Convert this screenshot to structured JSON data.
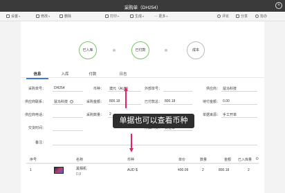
{
  "window": {
    "title": "采购单（DH254）"
  },
  "toolbar": {
    "settings": "设置",
    "edit": "修改",
    "delete": "删除",
    "print": "打印",
    "generate": "生成",
    "more": "更多",
    "comment": "评论",
    "share": "分享",
    "collab": "协办"
  },
  "steps": {
    "s1": "已入库",
    "s2": "已付款",
    "s3": "成本"
  },
  "tabs": {
    "info": "信息",
    "inbound": "入库",
    "payment": "付款",
    "log": "日志"
  },
  "fields": {
    "order_no_label": "采购单号：",
    "order_no": "DH254",
    "currency_label": "币种：",
    "currency": "澳元（AUD）",
    "ext_no_label": "外部单号：",
    "ext_no": "",
    "supplier_label": "供应商：",
    "supplier": "鼠马科技",
    "contact_label": "供应商联系：",
    "contact": "鼠马科技",
    "amount_label": "采购金额：",
    "amount": "800.18",
    "total_label": "已付款总：",
    "total": "800.18",
    "pending_label": "待付金额：",
    "pending": "0.00",
    "phone_label": "供应商电话：",
    "phone": "",
    "qty_label": "采购数量：",
    "qty": "2",
    "source_label": "单据来源：",
    "source": "手工开单",
    "delivery_label": "交货时间：",
    "delivery": "",
    "creator_label": "所属人员：",
    "creator": "黄继华",
    "remark_label": "备注：",
    "remark": ""
  },
  "table": {
    "headers": {
      "seq": "序号",
      "name": "名称",
      "currency": "币种",
      "price": "单价",
      "qty": "数量",
      "amount": "金额",
      "stocked": "已入库量"
    },
    "row": {
      "seq": "1",
      "name": "黑相机",
      "sku": "DJI",
      "currency": "AUD $",
      "price": "400.09",
      "qty": "2",
      "amount": "800.18",
      "stocked": "2"
    }
  },
  "overlay": {
    "caption": "单据也可以查看币种"
  },
  "colors": {
    "accent": "#3a7bd5",
    "step_done": "#7bc468",
    "annotation": "#e91e63"
  },
  "icons": {
    "close": "close-icon",
    "gear": "gear-icon",
    "help": "help-icon"
  }
}
